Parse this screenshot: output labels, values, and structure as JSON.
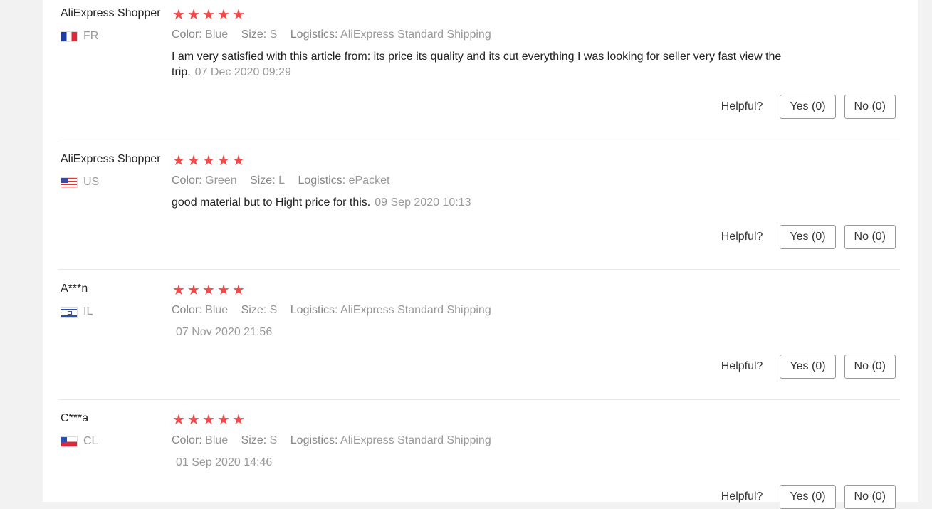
{
  "labels": {
    "color": "Color:",
    "size": "Size:",
    "logistics": "Logistics:",
    "helpful": "Helpful?",
    "yes": "Yes (0)",
    "no": "No (0)"
  },
  "star_color": "#f24a4a",
  "reviews": [
    {
      "user": "AliExpress Shopper",
      "country": "FR",
      "rating": 5,
      "color": "Blue",
      "size": "S",
      "logistics": "AliExpress Standard Shipping",
      "text": "I am very satisfied with this article from: its price its quality and its cut everything I was looking for seller very fast view the trip.",
      "date": "07 Dec 2020 09:29"
    },
    {
      "user": "AliExpress Shopper",
      "country": "US",
      "rating": 5,
      "color": "Green",
      "size": "L",
      "logistics": "ePacket",
      "text": "good material but to Hight price for this.",
      "date": "09 Sep 2020 10:13"
    },
    {
      "user": "A***n",
      "country": "IL",
      "rating": 5,
      "color": "Blue",
      "size": "S",
      "logistics": "AliExpress Standard Shipping",
      "text": "",
      "date": "07 Nov 2020 21:56"
    },
    {
      "user": "C***a",
      "country": "CL",
      "rating": 5,
      "color": "Blue",
      "size": "S",
      "logistics": "AliExpress Standard Shipping",
      "text": "",
      "date": "01 Sep 2020 14:46"
    }
  ]
}
